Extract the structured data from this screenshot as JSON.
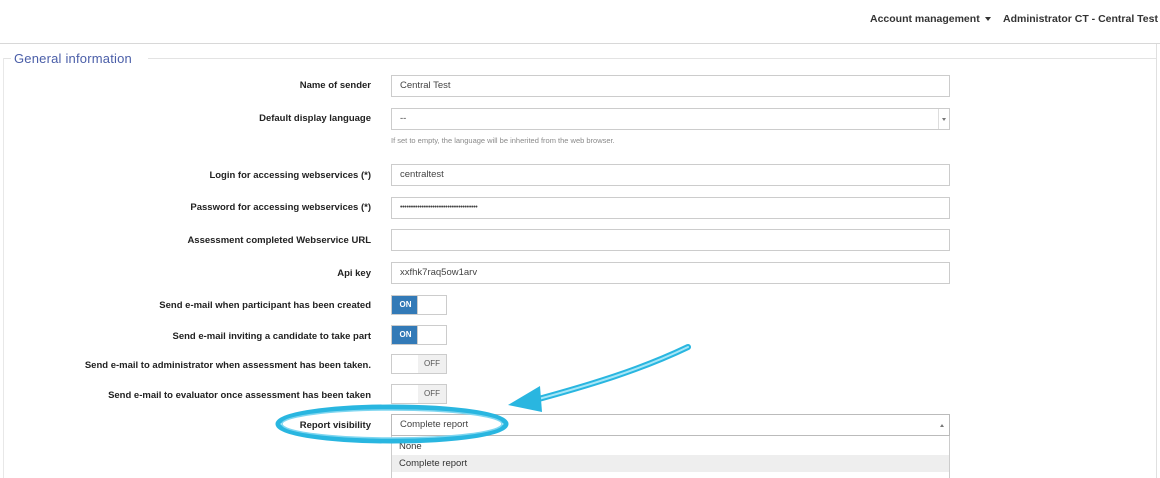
{
  "header": {
    "account_management": "Account management",
    "user_menu": "Administrator CT - Central Test"
  },
  "section": {
    "legend": "General information"
  },
  "fields": {
    "sender_name": {
      "label": "Name of sender",
      "value": "Central Test"
    },
    "display_language": {
      "label": "Default display language",
      "value": "--",
      "help": "If set to empty, the language will be inherited from the web browser."
    },
    "ws_login": {
      "label": "Login for accessing webservices (*)",
      "value": "centraltest"
    },
    "ws_password": {
      "label": "Password for accessing webservices (*)",
      "value": "••••••••••••••••••••••••••••••••••••"
    },
    "ws_url": {
      "label": "Assessment completed Webservice URL",
      "value": ""
    },
    "api_key": {
      "label": "Api key",
      "value": "xxfhk7raq5ow1arv"
    },
    "mail_participant_created": {
      "label": "Send e-mail when participant has been created",
      "state": "ON"
    },
    "mail_invite_candidate": {
      "label": "Send e-mail inviting a candidate to take part",
      "state": "ON"
    },
    "mail_admin_taken": {
      "label": "Send e-mail to administrator when assessment has been taken.",
      "state": "OFF"
    },
    "mail_evaluator_taken": {
      "label": "Send e-mail to evaluator once assessment has been taken",
      "state": "OFF"
    },
    "report_visibility": {
      "label": "Report visibility",
      "value": "Complete report",
      "options": [
        "None",
        "Complete report"
      ]
    }
  },
  "colors": {
    "toggle_on": "#337ab7",
    "legend": "#4a5ea8",
    "annotation": "#29b6e0"
  },
  "icons": {
    "dropdown_caret": "caret-down-icon",
    "annotation_arrow": "arrow-icon"
  }
}
